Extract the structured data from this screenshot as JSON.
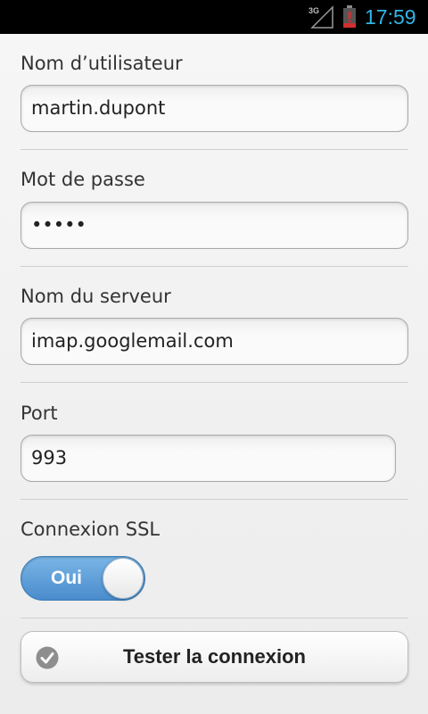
{
  "status_bar": {
    "network_type": "3G",
    "time": "17:59",
    "signal_icon": "signal-icon",
    "battery_icon": "battery-alert-icon",
    "time_color": "#33b5e5"
  },
  "form": {
    "username": {
      "label": "Nom d’utilisateur",
      "value": "martin.dupont"
    },
    "password": {
      "label": "Mot de passe",
      "value": "•••••"
    },
    "server": {
      "label": "Nom du serveur",
      "value": "imap.googlemail.com"
    },
    "port": {
      "label": "Port",
      "value": "993"
    },
    "ssl": {
      "label": "Connexion SSL",
      "toggle_label": "Oui",
      "enabled": true,
      "accent_color": "#5b9ad6"
    }
  },
  "actions": {
    "test_connection": {
      "label": "Tester la connexion",
      "icon": "check-circle-icon"
    }
  }
}
